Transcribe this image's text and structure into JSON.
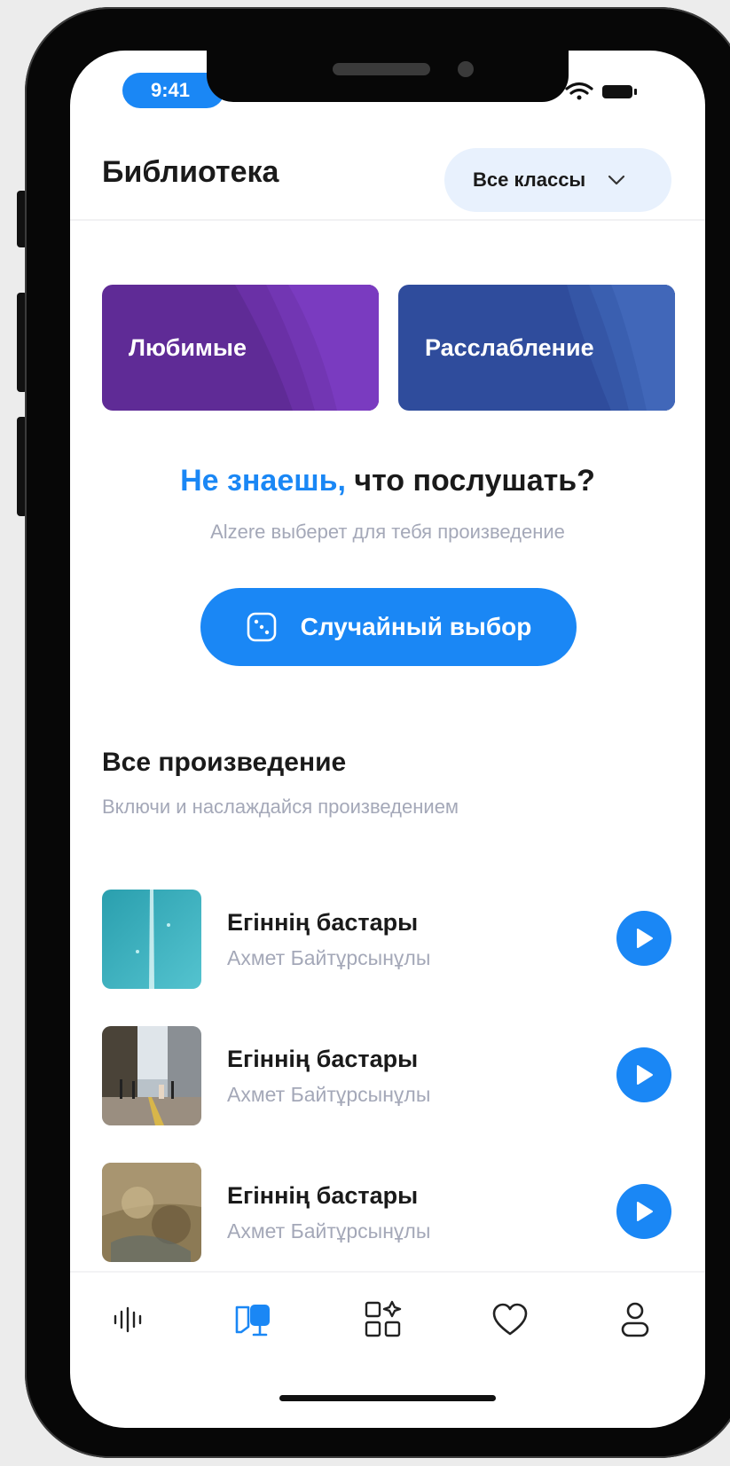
{
  "status_bar": {
    "time": "9:41"
  },
  "header": {
    "title": "Библиотека",
    "class_select_label": "Все классы"
  },
  "categories": [
    {
      "label": "Любимые",
      "color": "#5f2b96"
    },
    {
      "label": "Расслабление",
      "color": "#2f4c9c"
    }
  ],
  "prompt": {
    "question_accent": "Не знаешь,",
    "question_rest": " что послушать?",
    "subtitle": "Alzere выберет для тебя произведение",
    "button_label": "Случайный выбор"
  },
  "section": {
    "title": "Все произведение",
    "subtitle": "Включи и наслаждайся произведением"
  },
  "tracks": [
    {
      "title": "Егіннің бастары",
      "author": "Ахмет Байтұрсынұлы"
    },
    {
      "title": "Егіннің бастары",
      "author": "Ахмет Байтұрсынұлы"
    },
    {
      "title": "Егіннің бастары",
      "author": "Ахмет Байтұрсынұлы"
    }
  ],
  "tab_bar": {
    "items": [
      {
        "icon": "waveform-icon",
        "active": false
      },
      {
        "icon": "library-book-icon",
        "active": true
      },
      {
        "icon": "categories-icon",
        "active": false
      },
      {
        "icon": "heart-icon",
        "active": false
      },
      {
        "icon": "profile-icon",
        "active": false
      }
    ]
  },
  "colors": {
    "accent": "#1a87f5",
    "muted": "#a4a8b8",
    "text": "#1a1a1a"
  }
}
